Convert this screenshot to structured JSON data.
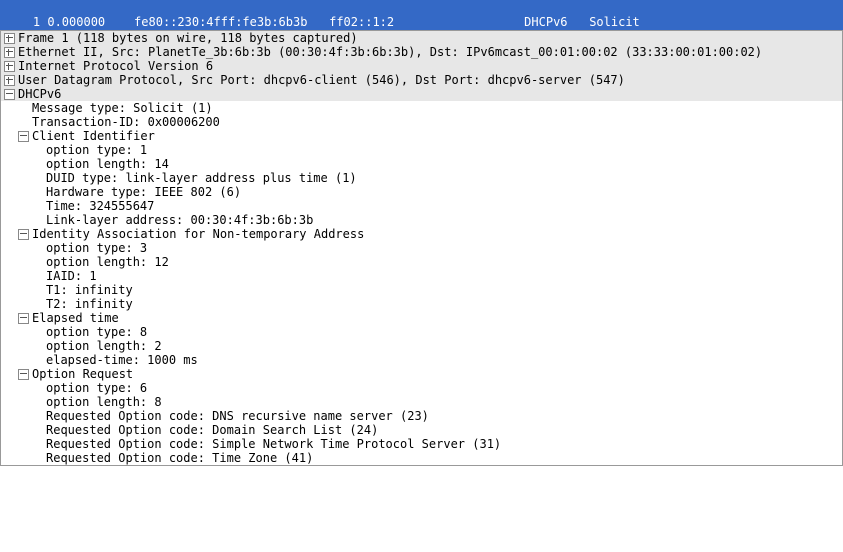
{
  "packet_list": {
    "row": "  1 0.000000    fe80::230:4fff:fe3b:6b3b   ff02::1:2                  DHCPv6   Solicit"
  },
  "frame": {
    "header": "Frame 1 (118 bytes on wire, 118 bytes captured)"
  },
  "eth": {
    "header": "Ethernet II, Src: PlanetTe_3b:6b:3b (00:30:4f:3b:6b:3b), Dst: IPv6mcast_00:01:00:02 (33:33:00:01:00:02)"
  },
  "ipv6": {
    "header": "Internet Protocol Version 6"
  },
  "udp": {
    "header": "User Datagram Protocol, Src Port: dhcpv6-client (546), Dst Port: dhcpv6-server (547)"
  },
  "dhcpv6": {
    "header": "DHCPv6",
    "msgtype": "Message type: Solicit (1)",
    "txid": "Transaction-ID: 0x00006200",
    "clientid": {
      "header": "Client Identifier",
      "opt_type": "option type: 1",
      "opt_len": "option length: 14",
      "duid_type": "DUID type: link-layer address plus time (1)",
      "hw_type": "Hardware type: IEEE 802 (6)",
      "time": "Time: 324555647",
      "lladdr": "Link-layer address: 00:30:4f:3b:6b:3b"
    },
    "iana": {
      "header": "Identity Association for Non-temporary Address",
      "opt_type": "option type: 3",
      "opt_len": "option length: 12",
      "iaid": "IAID: 1",
      "t1": "T1: infinity",
      "t2": "T2: infinity"
    },
    "elapsed": {
      "header": "Elapsed time",
      "opt_type": "option type: 8",
      "opt_len": "option length: 2",
      "value": "elapsed-time: 1000 ms"
    },
    "oro": {
      "header": "Option Request",
      "opt_type": "option type: 6",
      "opt_len": "option length: 8",
      "r1": "Requested Option code: DNS recursive name server (23)",
      "r2": "Requested Option code: Domain Search List (24)",
      "r3": "Requested Option code: Simple Network Time Protocol Server (31)",
      "r4": "Requested Option code: Time Zone (41)"
    }
  }
}
